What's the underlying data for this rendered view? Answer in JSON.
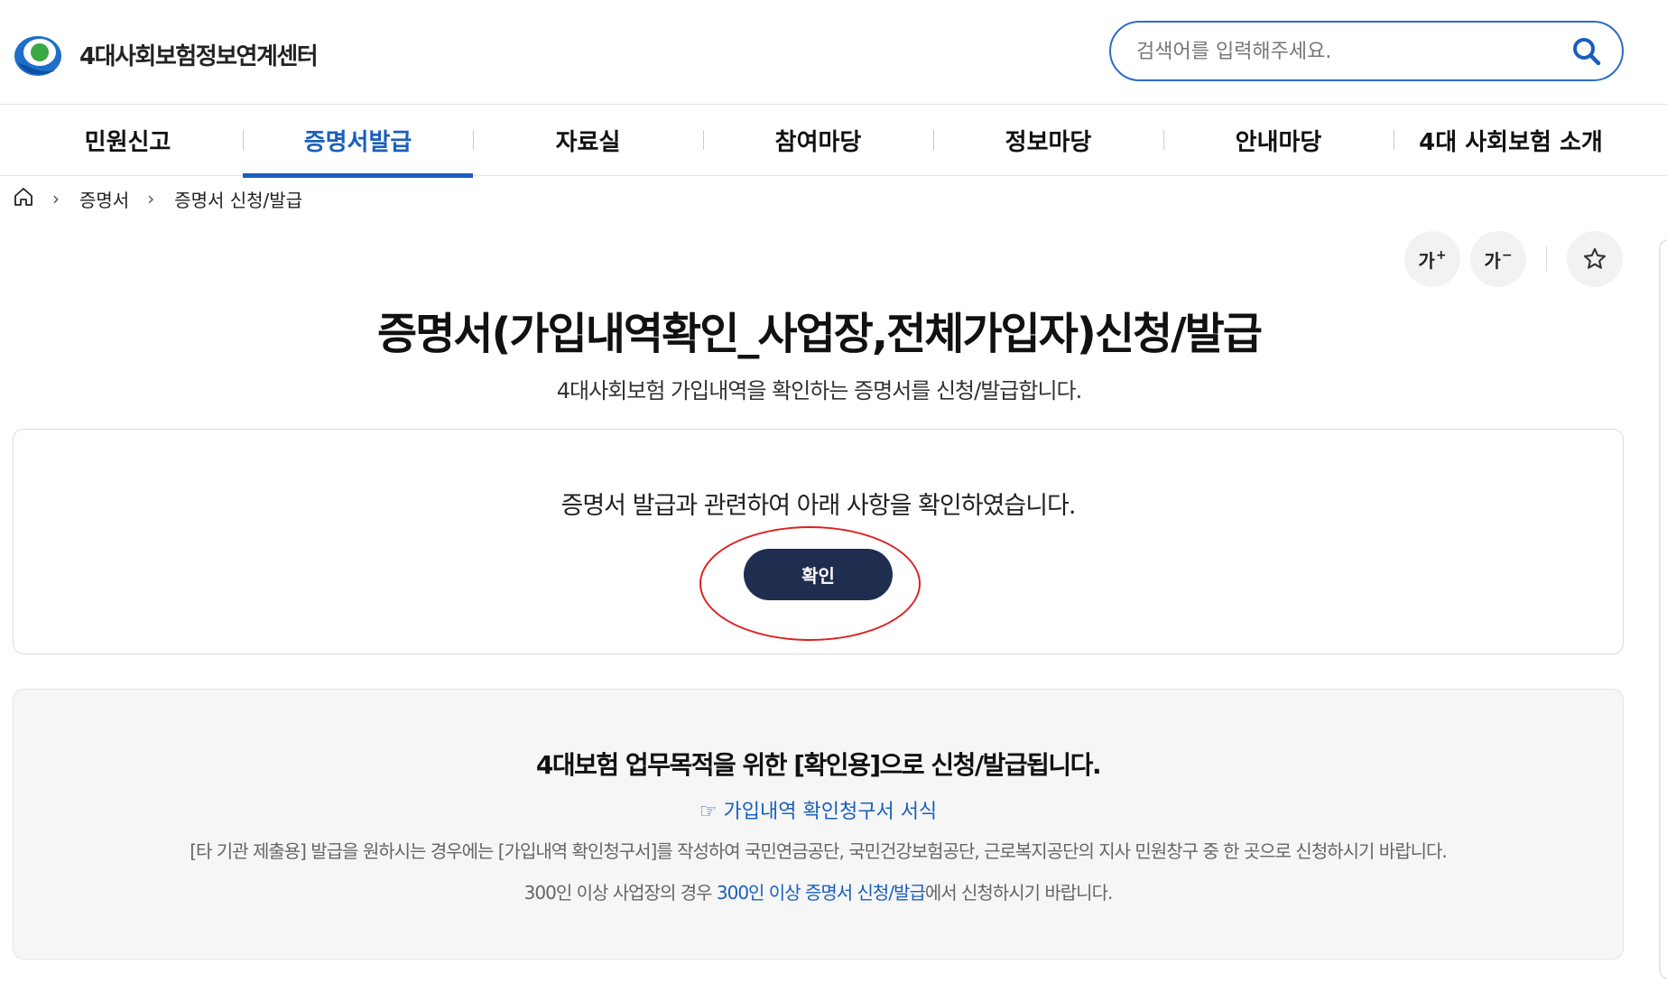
{
  "header": {
    "logo_text": "4대사회보험정보연계센터",
    "search_placeholder": "검색어를 입력해주세요."
  },
  "nav": {
    "items": [
      {
        "label": "민원신고",
        "active": false
      },
      {
        "label": "증명서발급",
        "active": true
      },
      {
        "label": "자료실",
        "active": false
      },
      {
        "label": "참여마당",
        "active": false
      },
      {
        "label": "정보마당",
        "active": false
      },
      {
        "label": "안내마당",
        "active": false
      },
      {
        "label": "4대 사회보험 소개",
        "active": false
      }
    ]
  },
  "breadcrumb": {
    "items": [
      "증명서",
      "증명서 신청/발급"
    ]
  },
  "tools": {
    "font_increase": "가",
    "font_decrease": "가"
  },
  "page": {
    "title": "증명서(가입내역확인_사업장,전체가입자)신청/발급",
    "subtitle": "4대사회보험 가입내역을 확인하는 증명서를 신청/발급합니다."
  },
  "confirm": {
    "text": "증명서 발급과 관련하여 아래 사항을 확인하였습니다.",
    "button_label": "확인"
  },
  "info": {
    "heading": "4대보험 업무목적을 위한 [확인용]으로 신청/발급됩니다.",
    "link_label": "☞ 가입내역 확인청구서 서식",
    "text": "[타 기관 제출용] 발급을 원하시는 경우에는 [가입내역 확인청구서]를 작성하여 국민연금공단, 국민건강보험공단, 근로복지공단의 지사 민원창구 중 한 곳으로 신청하시기 바랍니다.",
    "text2_prefix": "300인 이상 사업장의 경우 ",
    "text2_link": "300인 이상 증명서 신청/발급",
    "text2_suffix": "에서 신청하시기 바랍니다."
  },
  "colors": {
    "accent": "#1a5fbd",
    "button_dark": "#1f2d4e",
    "highlight": "#e02020"
  }
}
